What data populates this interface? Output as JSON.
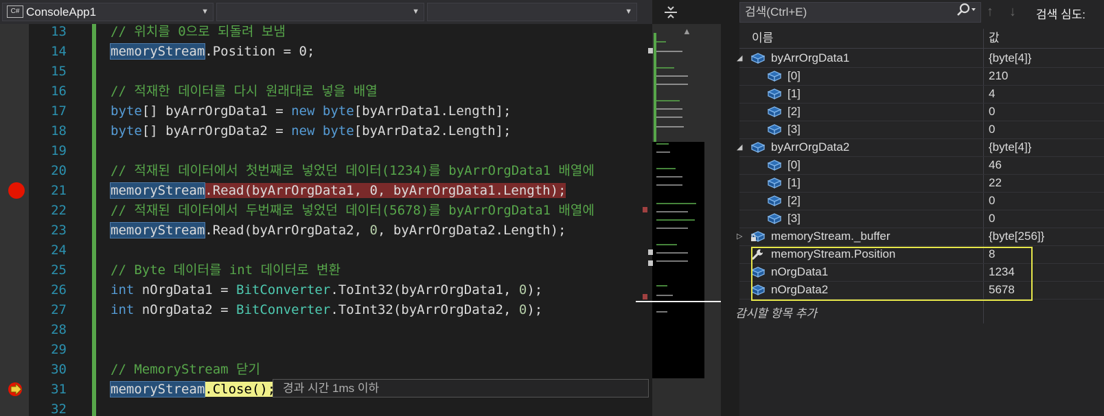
{
  "toolbar": {
    "project_name": "ConsoleApp1",
    "lang_badge": "C#",
    "split_icon": "⇔"
  },
  "editor": {
    "lines": [
      {
        "num": "13",
        "parts": [
          {
            "t": "// 위치를 0으로 되돌려 보냄",
            "c": "cm"
          }
        ]
      },
      {
        "num": "14",
        "parts": [
          {
            "t": "memoryStream",
            "c": "hl"
          },
          {
            "t": ".Position = 0;",
            "c": ""
          }
        ]
      },
      {
        "num": "15",
        "parts": []
      },
      {
        "num": "16",
        "parts": [
          {
            "t": "// 적재한 데이터를 다시 원래대로 넣을 배열",
            "c": "cm"
          }
        ]
      },
      {
        "num": "17",
        "parts": [
          {
            "t": "byte",
            "c": "kw"
          },
          {
            "t": "[] byArrOrgData1 = ",
            "c": ""
          },
          {
            "t": "new",
            "c": "kw"
          },
          {
            "t": " ",
            "c": ""
          },
          {
            "t": "byte",
            "c": "kw"
          },
          {
            "t": "[byArrData1.Length];",
            "c": ""
          }
        ]
      },
      {
        "num": "18",
        "parts": [
          {
            "t": "byte",
            "c": "kw"
          },
          {
            "t": "[] byArrOrgData2 = ",
            "c": ""
          },
          {
            "t": "new",
            "c": "kw"
          },
          {
            "t": " ",
            "c": ""
          },
          {
            "t": "byte",
            "c": "kw"
          },
          {
            "t": "[byArrData2.Length];",
            "c": ""
          }
        ]
      },
      {
        "num": "19",
        "parts": []
      },
      {
        "num": "20",
        "parts": [
          {
            "t": "// 적재된 데이터에서 첫번째로 넣었던 데이터(1234)를 byArrOrgData1 배열에",
            "c": "cm"
          }
        ]
      },
      {
        "num": "21",
        "breakpoint": true,
        "parts": [
          {
            "t": "memoryStream",
            "c": "hl"
          },
          {
            "t": ".Read(byArrOrgData1, 0, byArrOrgData1.Length);",
            "c": "bphl"
          }
        ]
      },
      {
        "num": "22",
        "parts": [
          {
            "t": "// 적재된 데이터에서 두번째로 넣었던 데이터(5678)를 byArrOrgData1 배열에",
            "c": "cm"
          }
        ]
      },
      {
        "num": "23",
        "parts": [
          {
            "t": "memoryStream",
            "c": "hl"
          },
          {
            "t": ".Read(byArrOrgData2, ",
            "c": ""
          },
          {
            "t": "0",
            "c": "nm"
          },
          {
            "t": ", byArrOrgData2.Length);",
            "c": ""
          }
        ]
      },
      {
        "num": "24",
        "parts": []
      },
      {
        "num": "25",
        "parts": [
          {
            "t": "// Byte 데이터를 int 데이터로 변환",
            "c": "cm"
          }
        ]
      },
      {
        "num": "26",
        "parts": [
          {
            "t": "int",
            "c": "kw"
          },
          {
            "t": " nOrgData1 = ",
            "c": ""
          },
          {
            "t": "BitConverter",
            "c": "ty"
          },
          {
            "t": ".ToInt32(byArrOrgData1, ",
            "c": ""
          },
          {
            "t": "0",
            "c": "nm"
          },
          {
            "t": ");",
            "c": ""
          }
        ]
      },
      {
        "num": "27",
        "parts": [
          {
            "t": "int",
            "c": "kw"
          },
          {
            "t": " nOrgData2 = ",
            "c": ""
          },
          {
            "t": "BitConverter",
            "c": "ty"
          },
          {
            "t": ".ToInt32(byArrOrgData2, ",
            "c": ""
          },
          {
            "t": "0",
            "c": "nm"
          },
          {
            "t": ");",
            "c": ""
          }
        ]
      },
      {
        "num": "28",
        "parts": []
      },
      {
        "num": "29",
        "parts": []
      },
      {
        "num": "30",
        "parts": [
          {
            "t": "// MemoryStream 닫기",
            "c": "cm"
          }
        ]
      },
      {
        "num": "31",
        "current": true,
        "parts": [
          {
            "t": "memoryStream",
            "c": "hl"
          },
          {
            "t": ".Close();",
            "c": "curhl"
          }
        ],
        "perf_tip": "경과 시간 1ms 이하"
      },
      {
        "num": "32",
        "parts": []
      }
    ]
  },
  "watch": {
    "search_placeholder": "검색(Ctrl+E)",
    "search_depth_label": "검색 심도:",
    "col_name": "이름",
    "col_value": "값",
    "add_watch_label": "감시할 항목 추가",
    "rows": [
      {
        "name": "byArrOrgData1",
        "value": "{byte[4]}",
        "level": 0,
        "expander": "expanded",
        "icon": "cube"
      },
      {
        "name": "[0]",
        "value": "210",
        "level": 1,
        "expander": "none",
        "icon": "cube"
      },
      {
        "name": "[1]",
        "value": "4",
        "level": 1,
        "expander": "none",
        "icon": "cube"
      },
      {
        "name": "[2]",
        "value": "0",
        "level": 1,
        "expander": "none",
        "icon": "cube"
      },
      {
        "name": "[3]",
        "value": "0",
        "level": 1,
        "expander": "none",
        "icon": "cube"
      },
      {
        "name": "byArrOrgData2",
        "value": "{byte[4]}",
        "level": 0,
        "expander": "expanded",
        "icon": "cube"
      },
      {
        "name": "[0]",
        "value": "46",
        "level": 1,
        "expander": "none",
        "icon": "cube"
      },
      {
        "name": "[1]",
        "value": "22",
        "level": 1,
        "expander": "none",
        "icon": "cube"
      },
      {
        "name": "[2]",
        "value": "0",
        "level": 1,
        "expander": "none",
        "icon": "cube"
      },
      {
        "name": "[3]",
        "value": "0",
        "level": 1,
        "expander": "none",
        "icon": "cube"
      },
      {
        "name": "memoryStream._buffer",
        "value": "{byte[256]}",
        "level": 0,
        "expander": "collapsed",
        "icon": "cube-lock"
      },
      {
        "name": "memoryStream.Position",
        "value": "8",
        "level": 0,
        "expander": "none",
        "icon": "wrench"
      },
      {
        "name": "nOrgData1",
        "value": "1234",
        "level": 0,
        "expander": "none",
        "icon": "cube"
      },
      {
        "name": "nOrgData2",
        "value": "5678",
        "level": 0,
        "expander": "none",
        "icon": "cube"
      }
    ]
  },
  "colors": {
    "editor_bg": "#1e1e1e",
    "comment": "#57a64a",
    "keyword": "#569cd6",
    "type": "#4ec9b0",
    "breakpoint": "#e51400",
    "highlight_box": "#e8e84a"
  }
}
